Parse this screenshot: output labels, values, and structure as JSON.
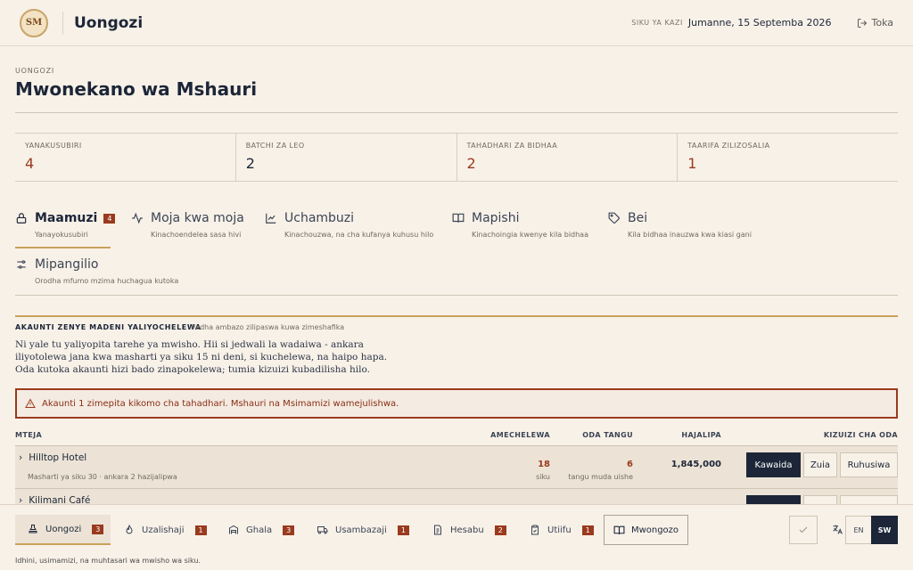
{
  "header": {
    "logo_text": "SM",
    "app_title": "Uongozi",
    "workday_label": "SIKU YA KAZI",
    "workday_date": "Jumanne, 15 Septemba 2026",
    "logout_label": "Toka"
  },
  "page": {
    "kicker": "UONGOZI",
    "title": "Mwonekano wa Mshauri"
  },
  "stats": [
    {
      "label": "YANAKUSUBIRI",
      "value": "4"
    },
    {
      "label": "BATCHI ZA LEO",
      "value": "2"
    },
    {
      "label": "TAHADHARI ZA BIDHAA",
      "value": "2"
    },
    {
      "label": "TAARIFA ZILIZOSALIA",
      "value": "1"
    }
  ],
  "nav": [
    {
      "title": "Maamuzi",
      "badge": "4",
      "sub": "Yanayokusubiri",
      "icon": "lock-icon"
    },
    {
      "title": "Moja kwa moja",
      "sub": "Kinachoendelea sasa hivi",
      "icon": "activity-icon"
    },
    {
      "title": "Uchambuzi",
      "sub": "Kinachouzwa, na cha kufanya kuhusu hilo",
      "icon": "line-chart-icon"
    },
    {
      "title": "Mapishi",
      "sub": "Kinachoingia kwenye kila bidhaa",
      "icon": "book-icon"
    },
    {
      "title": "Bei",
      "sub": "Kila bidhaa inauzwa kwa kiasi gani",
      "icon": "tag-icon"
    },
    {
      "title": "Mipangilio",
      "sub": "Orodha mfumo mzima huchagua kutoka",
      "icon": "sliders-icon"
    }
  ],
  "section": {
    "title": "AKAUNTI ZENYE MADENI YALIYOCHELEWA",
    "subtitle": "Fedha ambazo zilipaswa kuwa zimeshafika",
    "description": "Ni yale tu yaliyopita tarehe ya mwisho. Hii si jedwali la wadaiwa - ankara iliyotolewa jana kwa masharti ya siku 15 ni deni, si kuchelewa, na haipo hapa. Oda kutoka akaunti hizi bado zinapokelewa; tumia kizuizi kubadilisha hilo.",
    "alert": "Akaunti 1 zimepita kikomo cha tahadhari. Mshauri na Msimamizi wamejulishwa."
  },
  "table": {
    "columns": [
      "MTEJA",
      "AMECHELEWA",
      "ODA TANGU",
      "HAJALIPA",
      "KIZUIZI CHA ODA"
    ],
    "rows": [
      {
        "name": "Hilltop Hotel",
        "terms": "Masharti ya siku 30 · ankara 2 hazijalipwa",
        "late_value": "18",
        "late_unit": "siku",
        "orders_value": "6",
        "orders_unit": "tangu muda uishe",
        "balance": "1,845,000",
        "actions": [
          "Kawaida",
          "Zuia",
          "Ruhusiwa"
        ]
      },
      {
        "name": "Kilimani Café"
      }
    ]
  },
  "bottom": {
    "tabs": [
      {
        "label": "Uongozi",
        "badge": "3"
      },
      {
        "label": "Uzalishaji",
        "badge": "1"
      },
      {
        "label": "Ghala",
        "badge": "3"
      },
      {
        "label": "Usambazaji",
        "badge": "1"
      },
      {
        "label": "Hesabu",
        "badge": "2"
      },
      {
        "label": "Utiifu",
        "badge": "1"
      }
    ],
    "guide_label": "Mwongozo",
    "lang_en": "EN",
    "lang_sw": "SW",
    "footnote": "Idhini, usimamizi, na muhtasari wa mwisho wa siku."
  },
  "colors": {
    "background": "#f8f1e8",
    "navy": "#1c2638",
    "accent_red": "#9a3a1e",
    "gold": "#c9a15a"
  }
}
